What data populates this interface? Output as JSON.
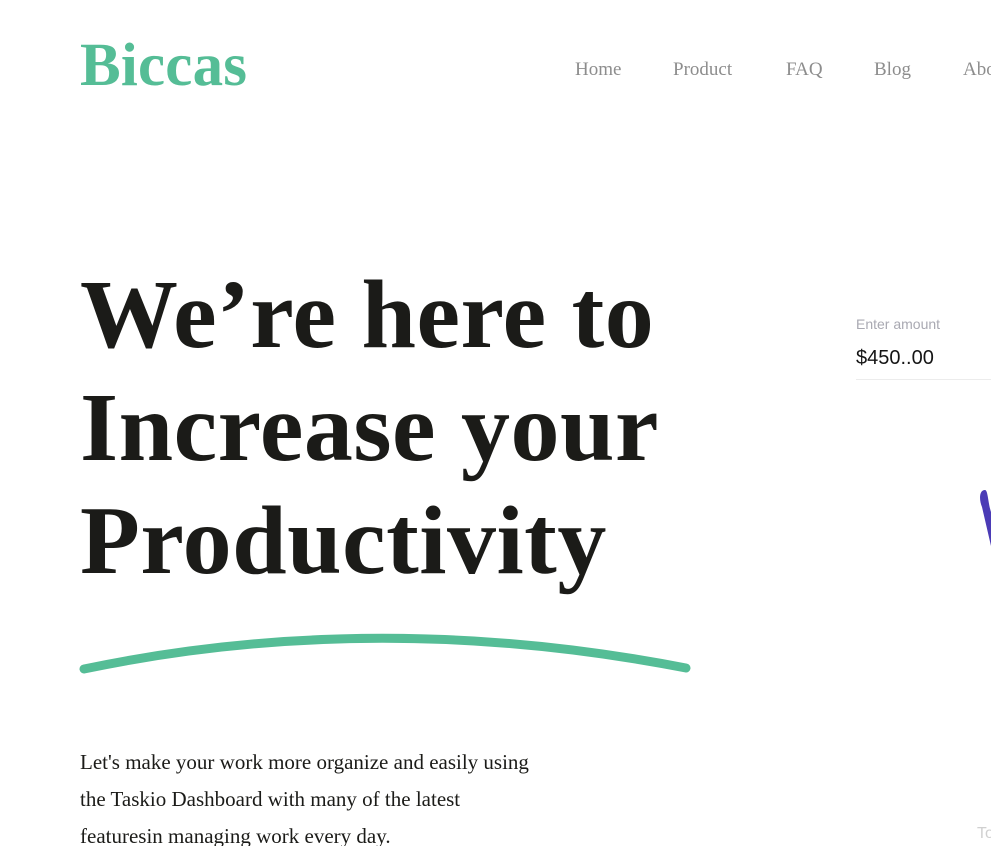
{
  "header": {
    "logo": "Biccas",
    "nav": [
      {
        "label": "Home"
      },
      {
        "label": "Product"
      },
      {
        "label": "FAQ"
      },
      {
        "label": "Blog"
      },
      {
        "label": "Abo"
      }
    ]
  },
  "hero": {
    "title_lines": [
      "We’re here to",
      "Increase your",
      "Productivity"
    ],
    "description_lines": [
      "Let's make your work more organize and easily using",
      "the Taskio Dashboard with many of the latest",
      "featuresin managing work every day."
    ]
  },
  "amount_card": {
    "label": "Enter amount",
    "value": "$450..00"
  },
  "partial_text": "To",
  "colors": {
    "brand": "#55bd96",
    "heading": "#1b1b18",
    "nav": "#8d8d8d",
    "underline": "#55bd96",
    "accent_shape": "#4b3bb6"
  },
  "icons": {
    "underline": "curved-underline-decoration",
    "purple_shape": "purple-decorative-shape"
  }
}
